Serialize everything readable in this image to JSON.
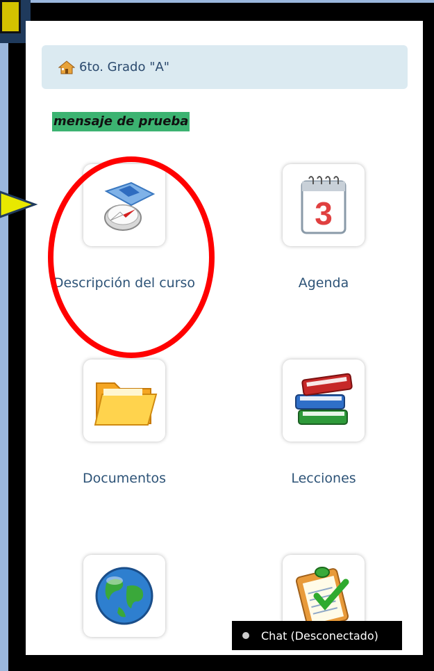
{
  "breadcrumb": {
    "label": "6to. Grado \"A\"",
    "icon": "home-icon"
  },
  "message": {
    "text": "mensaje de prueba"
  },
  "tools": [
    {
      "label": "Descripción del curso",
      "icon": "compass-map-icon"
    },
    {
      "label": "Agenda",
      "icon": "calendar-icon"
    },
    {
      "label": "Documentos",
      "icon": "folder-icon"
    },
    {
      "label": "Lecciones",
      "icon": "books-icon"
    },
    {
      "label": "",
      "icon": "globe-icon"
    },
    {
      "label": "",
      "icon": "clipboard-check-icon"
    }
  ],
  "chat": {
    "label": "Chat (Desconectado)",
    "status_color": "#cccccc"
  },
  "colors": {
    "frame": "#9ab7dd",
    "highlight": "#ff0000",
    "message_bg": "#3cb371",
    "arrow": "#e8e800"
  }
}
